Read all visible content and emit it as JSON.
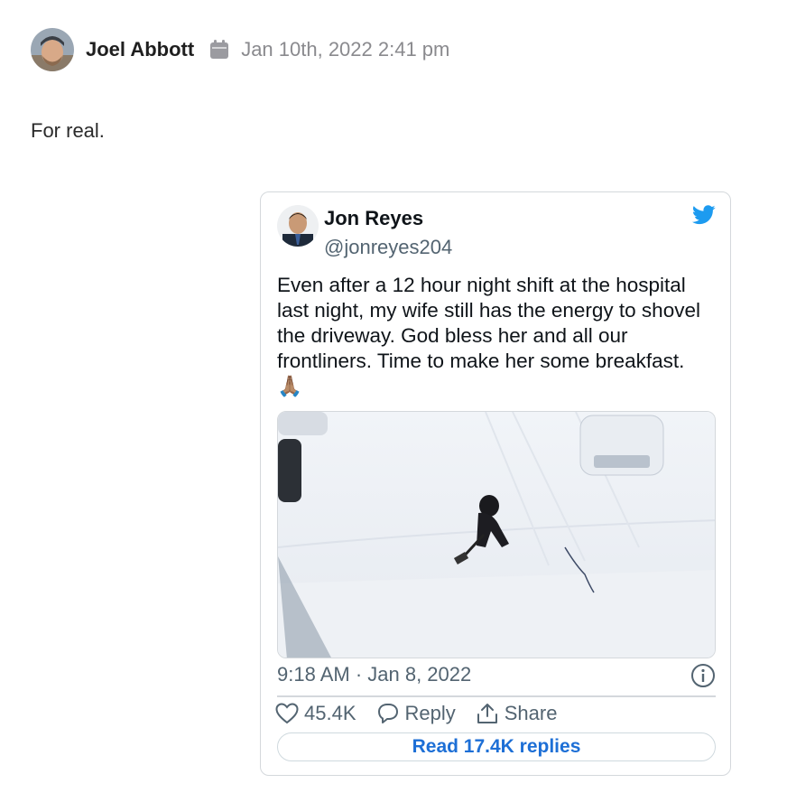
{
  "post": {
    "author": "Joel Abbott",
    "date": "Jan 10th, 2022 2:41 pm",
    "body": "For real."
  },
  "tweet": {
    "name": "Jon Reyes",
    "handle": "@jonreyes204",
    "text": "Even after a 12 hour night shift at the hospital last night, my wife still has the energy to shovel the driveway. God bless her and all our frontliners. Time to make her some breakfast. 🙏🏽",
    "timestamp": "9:18 AM · Jan 8, 2022",
    "likes": "45.4K",
    "reply_label": "Reply",
    "share_label": "Share",
    "read_replies": "Read 17.4K replies"
  },
  "icons": {
    "calendar": "calendar-icon",
    "twitter": "twitter-bird-icon",
    "info": "info-icon",
    "heart": "heart-icon",
    "reply": "reply-icon",
    "share": "share-icon"
  },
  "colors": {
    "twitter_blue": "#1d9bf0",
    "link_blue": "#1d6fd6",
    "muted": "#536471"
  }
}
